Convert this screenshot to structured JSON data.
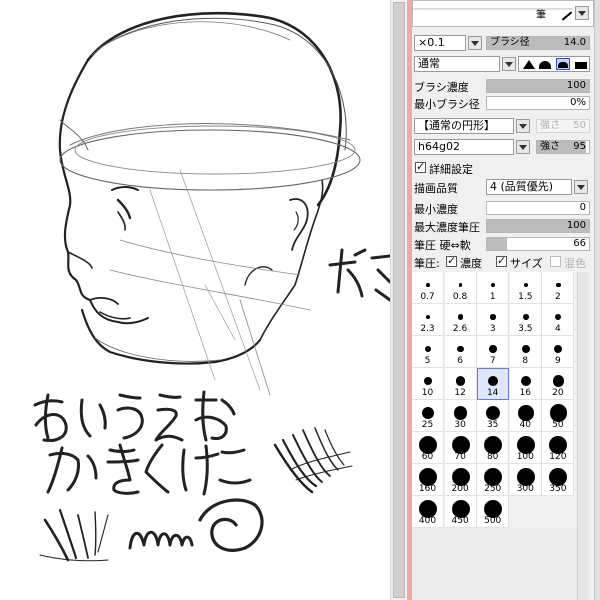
{
  "tool_panel": {
    "top_box_label": "筆",
    "scale": {
      "value": "×0.1"
    },
    "brush_size": {
      "label": "ブラシ径",
      "value": "14.0"
    },
    "blend_mode": {
      "value": "通常"
    },
    "brush_density": {
      "label": "ブラシ濃度",
      "value": "100",
      "level": 1.0
    },
    "min_size": {
      "label": "最小ブラシ径",
      "value": "0%",
      "level": 0.0
    },
    "shape": {
      "value": "【通常の円形】",
      "strength_label": "強さ",
      "strength_value": "50"
    },
    "texture": {
      "value": "h64g02",
      "strength_label": "強さ",
      "strength_value": "95"
    },
    "advanced": {
      "label": "詳細設定",
      "checked": true
    },
    "quality": {
      "label": "描画品質",
      "value": "4 (品質優先)"
    },
    "min_density": {
      "label": "最小濃度",
      "value": "0",
      "level": 0.0
    },
    "max_pressure": {
      "label": "最大濃度筆圧",
      "value": "100",
      "level": 1.0
    },
    "pressure_hardness": {
      "label": "筆圧 硬⇔軟",
      "value": "66",
      "level": 0.2
    },
    "pressure_row": {
      "label": "筆圧:",
      "density": {
        "label": "濃度",
        "checked": true
      },
      "size": {
        "label": "サイズ",
        "checked": true
      },
      "blend": {
        "label": "混色",
        "checked": false
      }
    },
    "brush_sizes": [
      "0.7",
      "0.8",
      "1",
      "1.5",
      "2",
      "2.3",
      "2.6",
      "3",
      "3.5",
      "4",
      "5",
      "6",
      "7",
      "8",
      "9",
      "10",
      "12",
      "14",
      "16",
      "20",
      "25",
      "30",
      "35",
      "40",
      "50",
      "60",
      "70",
      "80",
      "100",
      "120",
      "160",
      "200",
      "250",
      "300",
      "350",
      "400",
      "450",
      "500"
    ],
    "selected_size": "14"
  },
  "canvas": {
    "handwriting_line1": "あいうえお",
    "handwriting_line2": "かきくけこ"
  }
}
